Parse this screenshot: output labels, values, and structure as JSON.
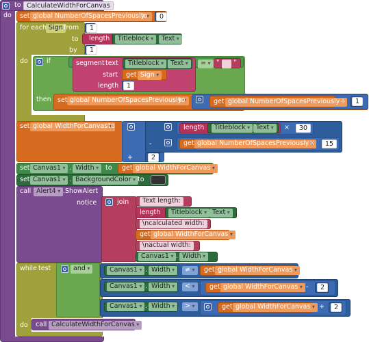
{
  "procedure": {
    "kw_to": "to",
    "name": "CalculateWidthForCanvas",
    "kw_do": "do"
  },
  "set_prev": {
    "kw_set": "set",
    "var": "global NumberOfSpacesPreviously",
    "kw_to": "to",
    "value": "0"
  },
  "foreach": {
    "kw": "for each",
    "var": "Sign",
    "kw_from": "from",
    "from": "1",
    "kw_to": "to",
    "kw_length": "length",
    "comp": "Titleblock",
    "prop": "Text",
    "kw_by": "by",
    "by": "1",
    "kw_do": "do"
  },
  "if_block": {
    "kw_if": "if",
    "kw_segment": "segment",
    "kw_text": "text",
    "comp": "Titleblock",
    "prop": "Text",
    "op": "=",
    "str": "",
    "kw_start": "start",
    "kw_get": "get",
    "start_var": "Sign",
    "kw_length": "length",
    "length": "1",
    "kw_then": "then"
  },
  "then_set": {
    "kw_set": "set",
    "var": "global NumberOfSpacesPreviously",
    "kw_to": "to",
    "kw_get": "get",
    "get_var": "global NumberOfSpacesPreviously",
    "op": "+",
    "num": "1"
  },
  "set_width": {
    "kw_set": "set",
    "var": "global WidthForCanvas",
    "kw_to": "to",
    "kw_length": "length",
    "comp": "Titleblock",
    "prop": "Text",
    "times": "×",
    "n30": "30",
    "minus": "-",
    "kw_get": "get",
    "get_var": "global NumberOfSpacesPreviously",
    "times2": "×",
    "n15": "15",
    "plus": "+",
    "n2": "2"
  },
  "set_canvas_width": {
    "kw_set": "set",
    "comp": "Canvas1",
    "prop": "Width",
    "kw_to": "to",
    "kw_get": "get",
    "var": "global WidthForCanvas"
  },
  "set_canvas_bg": {
    "kw_set": "set",
    "comp": "Canvas1",
    "prop": "BackgroundColor",
    "kw_to": "to"
  },
  "alert": {
    "kw_call": "call",
    "comp": "Alert4",
    "method": ".ShowAlert",
    "kw_notice": "notice",
    "kw_join": "join",
    "s1": "Text length: ",
    "kw_length": "length",
    "comp2": "Titleblock",
    "prop2": "Text",
    "s2": "\\ncalculated width: ",
    "kw_get": "get",
    "var": "global WidthForCanvas",
    "s3": "\\nactual width: ",
    "comp3": "Canvas1",
    "prop3": "Width"
  },
  "while_block": {
    "kw_while": "while",
    "kw_test": "test",
    "kw_and": "and",
    "c1": {
      "comp": "Canvas1",
      "prop": "Width",
      "op": "≠",
      "kw_get": "get",
      "var": "global WidthForCanvas"
    },
    "c2": {
      "comp": "Canvas1",
      "prop": "Width",
      "op": "<",
      "kw_get": "get",
      "var": "global WidthForCanvas",
      "minus": "-",
      "num": "2"
    },
    "c3": {
      "comp": "Canvas1",
      "prop": "Width",
      "op": ">",
      "kw_get": "get",
      "var": "global WidthForCanvas",
      "plus": "+",
      "num": "2"
    },
    "kw_do": "do",
    "kw_call": "call",
    "call_name": "CalculateWidthForCanvas"
  },
  "colors": {
    "procedure": "#7a4b8f",
    "variable": "#d66a1e",
    "loop": "#a0a13a",
    "math": "#2e5d9b",
    "component": "#2d6b3c",
    "text": "#b53e5e",
    "logic": "#6aa84f",
    "color_swatch": "#333333"
  }
}
